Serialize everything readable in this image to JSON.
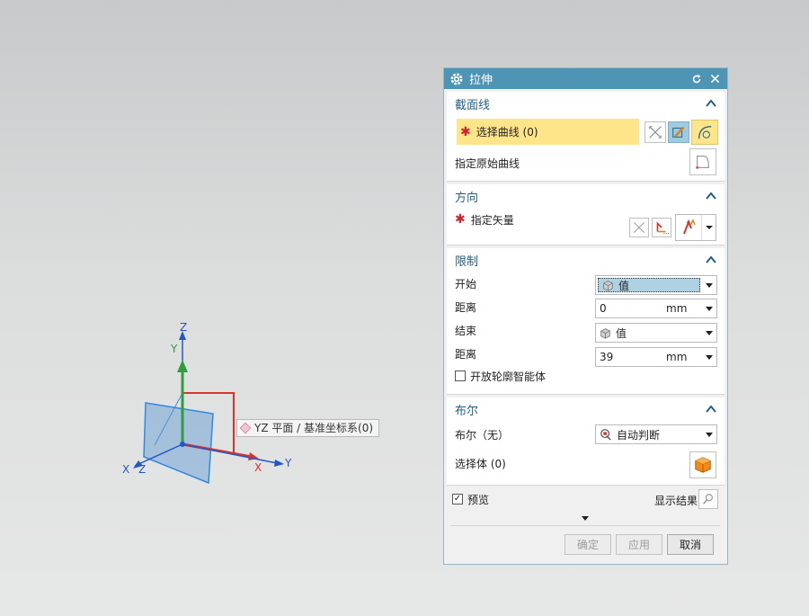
{
  "viewport": {
    "tooltip": "YZ 平面 / 基准坐标系(0)",
    "axes": {
      "x1": "X",
      "y1": "Y",
      "z1": "Z",
      "x2": "X",
      "y2": "Y",
      "z2": "Z"
    },
    "colors": {
      "x_axis": "#d9342a",
      "y_axis": "#2f9d3f",
      "z_axis": "#2457c6",
      "plane": "#3f8fd4"
    }
  },
  "dialog": {
    "title": "拉伸",
    "section_curve": {
      "title": "截面线",
      "select_curve": "选择曲线 (0)",
      "specify_original": "指定原始曲线"
    },
    "direction": {
      "title": "方向",
      "specify_vector": "指定矢量"
    },
    "limits": {
      "title": "限制",
      "start_label": "开始",
      "start_value": "值",
      "distance1_label": "距离",
      "distance1_value": "0",
      "distance1_unit": "mm",
      "end_label": "结束",
      "end_value": "值",
      "distance2_label": "距离",
      "distance2_value": "39",
      "distance2_unit": "mm",
      "open_profile": "开放轮廓智能体"
    },
    "boolean": {
      "title": "布尔",
      "bool_label": "布尔（无）",
      "bool_value": "自动判断",
      "select_body": "选择体 (0)"
    },
    "preview_label": "预览",
    "show_result": "显示结果",
    "buttons": {
      "ok": "确定",
      "apply": "应用",
      "cancel": "取消"
    },
    "colors": {
      "title_bar": "#4d94b5",
      "section_title": "#1f5f87",
      "highlight": "#ffe58a",
      "required": "#d6212a"
    }
  }
}
